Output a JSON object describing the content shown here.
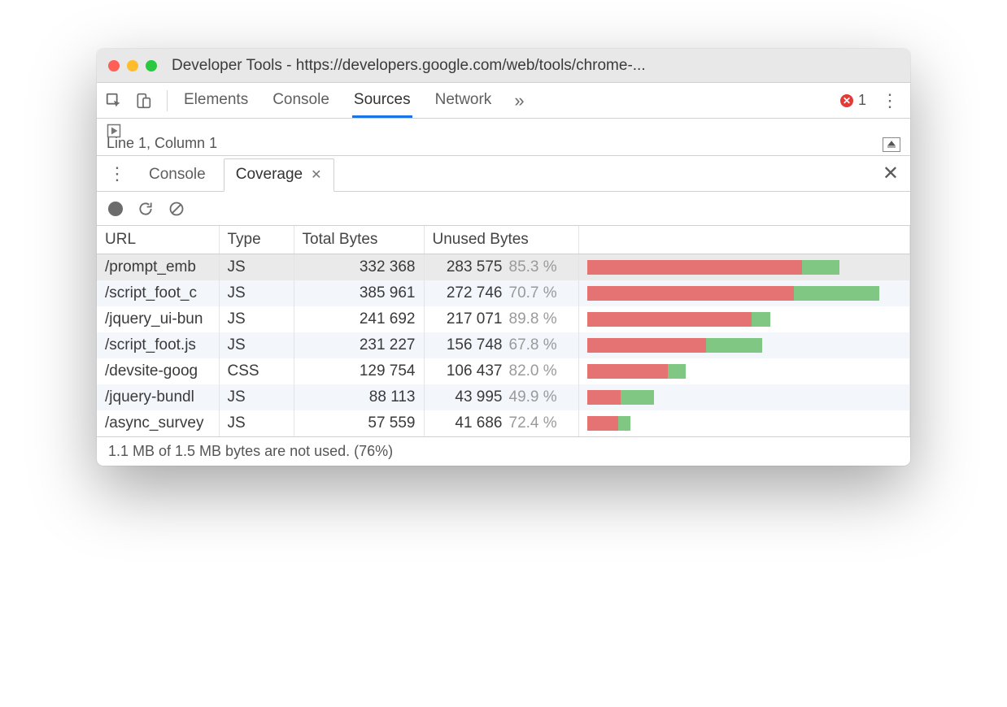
{
  "window": {
    "title": "Developer Tools - https://developers.google.com/web/tools/chrome-..."
  },
  "toolbar": {
    "tabs": [
      "Elements",
      "Console",
      "Sources",
      "Network"
    ],
    "active_index": 2,
    "overflow_glyph": "»",
    "error_count": "1"
  },
  "midbar": {
    "cursor": "Line 1, Column 1"
  },
  "drawer": {
    "tabs": [
      {
        "label": "Console",
        "active": false,
        "closable": false
      },
      {
        "label": "Coverage",
        "active": true,
        "closable": true
      }
    ]
  },
  "coverage": {
    "headers": {
      "url": "URL",
      "type": "Type",
      "total": "Total Bytes",
      "unused": "Unused Bytes"
    },
    "max_total": 385961,
    "rows": [
      {
        "url": "/prompt_emb",
        "type": "JS",
        "total": "332 368",
        "total_n": 332368,
        "unused": "283 575",
        "unused_n": 283575,
        "pct": "85.3 %",
        "selected": true
      },
      {
        "url": "/script_foot_c",
        "type": "JS",
        "total": "385 961",
        "total_n": 385961,
        "unused": "272 746",
        "unused_n": 272746,
        "pct": "70.7 %"
      },
      {
        "url": "/jquery_ui-bun",
        "type": "JS",
        "total": "241 692",
        "total_n": 241692,
        "unused": "217 071",
        "unused_n": 217071,
        "pct": "89.8 %"
      },
      {
        "url": "/script_foot.js",
        "type": "JS",
        "total": "231 227",
        "total_n": 231227,
        "unused": "156 748",
        "unused_n": 156748,
        "pct": "67.8 %"
      },
      {
        "url": "/devsite-goog",
        "type": "CSS",
        "total": "129 754",
        "total_n": 129754,
        "unused": "106 437",
        "unused_n": 106437,
        "pct": "82.0 %"
      },
      {
        "url": "/jquery-bundl",
        "type": "JS",
        "total": "88 113",
        "total_n": 88113,
        "unused": "43 995",
        "unused_n": 43995,
        "pct": "49.9 %"
      },
      {
        "url": "/async_survey",
        "type": "JS",
        "total": "57 559",
        "total_n": 57559,
        "unused": "41 686",
        "unused_n": 41686,
        "pct": "72.4 %"
      }
    ]
  },
  "footer": {
    "summary": "1.1 MB of 1.5 MB bytes are not used. (76%)"
  }
}
